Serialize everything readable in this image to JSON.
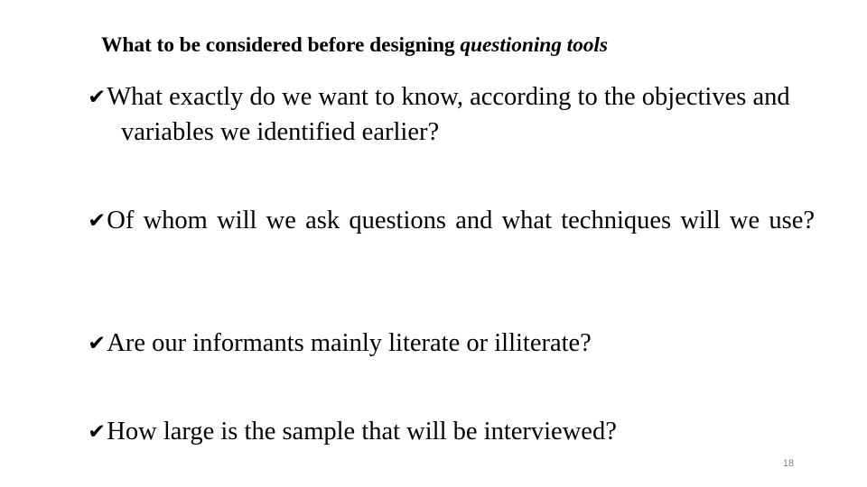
{
  "slide": {
    "page_number": "18",
    "background_color": "#ffffff",
    "text_color": "#000000",
    "page_number_color": "#808080",
    "title": {
      "text_plain": "What to be considered before designing questioning tools",
      "regular_part": "What to be considered before designing ",
      "italic_part": "questioning tools"
    },
    "bullets": [
      {
        "marker": "check-mark",
        "marker_glyph": "✔",
        "text": "What exactly do we want to know, according to the objectives and variables we identified earlier?",
        "alignment": "left"
      },
      {
        "marker": "check-mark",
        "marker_glyph": "✔",
        "text": "Of whom will we ask questions and what techniques will we use?",
        "alignment": "justify"
      },
      {
        "marker": "check-mark",
        "marker_glyph": "✔",
        "text": "Are our informants mainly literate or illiterate?",
        "alignment": "left"
      },
      {
        "marker": "check-mark",
        "marker_glyph": "✔",
        "text": "How large is the sample that will be interviewed?",
        "alignment": "left"
      }
    ]
  }
}
